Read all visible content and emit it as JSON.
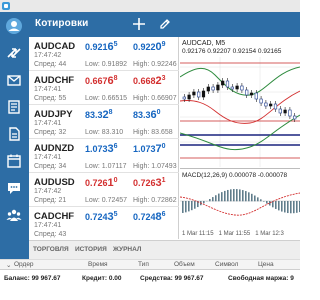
{
  "app": {
    "title": "Котировки"
  },
  "quotes": [
    {
      "symbol": "AUDCAD",
      "time": "17:47:42",
      "meta": "Спред: 44",
      "bid_main": "0.921",
      "bid_big": "6",
      "bid_sup": "5",
      "ask_main": "0.922",
      "ask_big": "0",
      "ask_sup": "9",
      "low": "Low: 0.91892",
      "high": "High: 0.92246",
      "bid_dir": "up",
      "ask_dir": "up"
    },
    {
      "symbol": "AUDCHF",
      "time": "17:47:41",
      "meta": "Спред: 55",
      "bid_main": "0.667",
      "bid_big": "6",
      "bid_sup": "8",
      "ask_main": "0.668",
      "ask_big": "2",
      "ask_sup": "3",
      "low": "Low: 0.66515",
      "high": "High: 0.66907",
      "bid_dir": "down",
      "ask_dir": "down"
    },
    {
      "symbol": "AUDJPY",
      "time": "17:47:41",
      "meta": "Спред: 32",
      "bid_main": "83.3",
      "bid_big": "2",
      "bid_sup": "8",
      "ask_main": "83.3",
      "ask_big": "6",
      "ask_sup": "0",
      "low": "Low: 83.310",
      "high": "High: 83.658",
      "bid_dir": "up",
      "ask_dir": "up"
    },
    {
      "symbol": "AUDNZD",
      "time": "17:47:41",
      "meta": "Спред: 34",
      "bid_main": "1.073",
      "bid_big": "3",
      "bid_sup": "6",
      "ask_main": "1.073",
      "ask_big": "7",
      "ask_sup": "0",
      "low": "Low: 1.07117",
      "high": "High: 1.07493",
      "bid_dir": "up",
      "ask_dir": "up"
    },
    {
      "symbol": "AUDUSD",
      "time": "17:47:42",
      "meta": "Спред: 21",
      "bid_main": "0.726",
      "bid_big": "1",
      "bid_sup": "0",
      "ask_main": "0.726",
      "ask_big": "3",
      "ask_sup": "1",
      "low": "Low: 0.72457",
      "high": "High: 0.72862",
      "bid_dir": "down",
      "ask_dir": "down"
    },
    {
      "symbol": "CADCHF",
      "time": "17:47:41",
      "meta": "Спред: 43",
      "bid_main": "0.724",
      "bid_big": "3",
      "bid_sup": "5",
      "ask_main": "0.724",
      "ask_big": "8",
      "ask_sup": "6",
      "low": "",
      "high": "",
      "bid_dir": "up",
      "ask_dir": "up"
    }
  ],
  "chart": {
    "symbol_tf": "AUDCAD, M5",
    "ohlc": "0.92176  0.92207  0.92154  0.92165",
    "macd_label": "MACD(12,26,9)  0.000078  -0.000078",
    "time_labels": [
      "1 Mar 11:15",
      "1 Mar 11:55",
      "1 Mar 12:3"
    ],
    "colors": {
      "bull": "#1e3d8f",
      "bear": "#111111",
      "band": "#2e8b3e",
      "ma": "#d32f2f",
      "level": "#c62828"
    }
  },
  "terminal_tabs": [
    "ТОРГОВЛЯ",
    "ИСТОРИЯ",
    "ЖУРНАЛ"
  ],
  "orders_header": [
    "Ордер",
    "Время",
    "Тип",
    "Объем",
    "Символ",
    "Цена"
  ],
  "footer": {
    "balance_label": "Баланс:",
    "balance_value": "99 967.67",
    "credit_label": "Кредит:",
    "credit_value": "0.00",
    "equity_label": "Средства:",
    "equity_value": "99 967.67",
    "free_margin_label": "Свободная маржа:",
    "free_margin_value": "9"
  },
  "icons": [
    "avatar-icon",
    "trade-icon",
    "mail-icon",
    "news-icon",
    "chat-icon",
    "community-icon",
    "plus-icon",
    "pencil-icon"
  ]
}
